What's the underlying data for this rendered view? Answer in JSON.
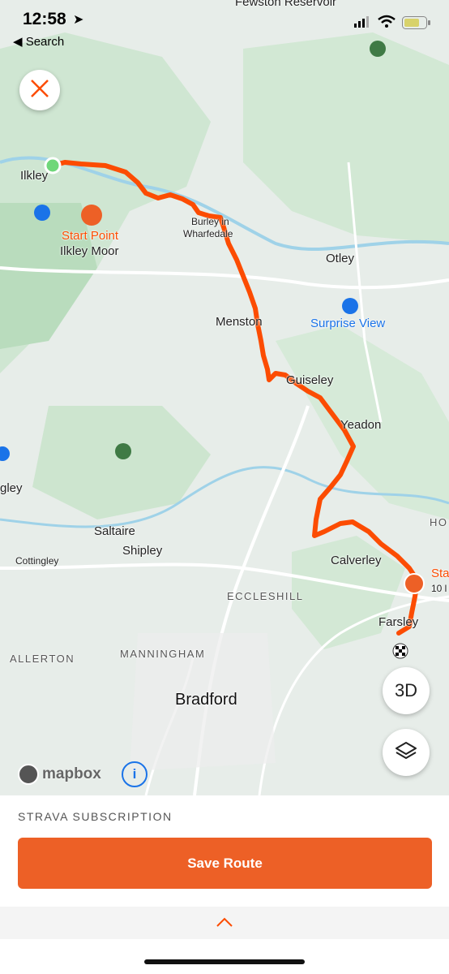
{
  "status_bar": {
    "time": "12:58",
    "back_label": "Search"
  },
  "map": {
    "places": {
      "top_reservoir": "Fewston Reservoir",
      "ilkley": "Ilkley",
      "start_point_1": "Start Point",
      "start_point_2": "Ilkley Moor",
      "burley_1": "Burley in",
      "burley_2": "Wharfedale",
      "otley": "Otley",
      "menston": "Menston",
      "surprise_view": "Surprise View",
      "guiseley": "Guiseley",
      "yeadon": "Yeadon",
      "gley": "gley",
      "saltaire": "Saltaire",
      "shipley": "Shipley",
      "cottingley": "Cottingley",
      "calverley": "Calverley",
      "eccleshill": "ECCLESHILL",
      "farsley": "Farsley",
      "allerton": "ALLERTON",
      "manningham": "MANNINGHAM",
      "bradford": "Bradford",
      "hor": "HO",
      "sta_1": "Sta",
      "sta_2": "10 l"
    },
    "attribution": "mapbox",
    "three_d_label": "3D",
    "route_color": "#fc4c02"
  },
  "sheet": {
    "subscription_label": "STRAVA SUBSCRIPTION",
    "save_label": "Save Route"
  }
}
